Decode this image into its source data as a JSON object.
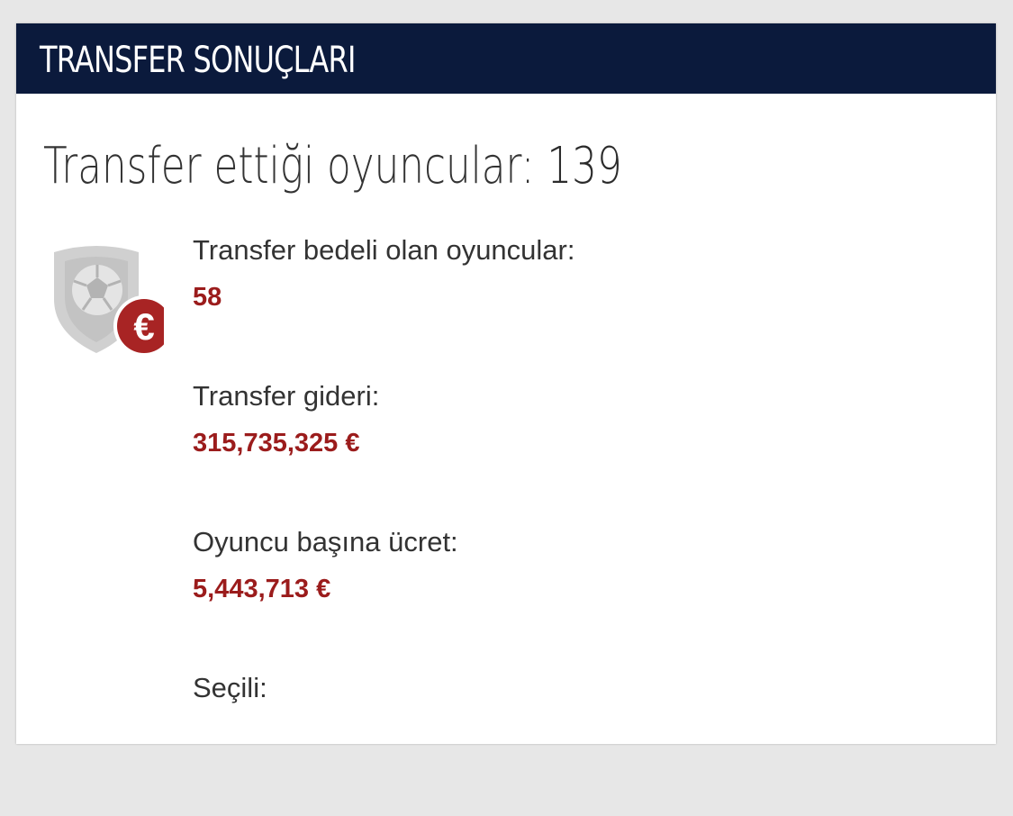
{
  "header": {
    "title": "TRANSFER SONUÇLARI"
  },
  "summary": {
    "label": "Transfer ettiği oyuncular:",
    "count": "139"
  },
  "stats": [
    {
      "label": "Transfer bedeli olan oyuncular:",
      "value": "58"
    },
    {
      "label": "Transfer gideri:",
      "value": "315,735,325 €"
    },
    {
      "label": "Oyuncu başına ücret:",
      "value": "5,443,713 €"
    },
    {
      "label": "Seçili:",
      "value": ""
    }
  ],
  "icons": {
    "badge": "shield-ball-euro-icon",
    "euro_symbol": "€"
  },
  "colors": {
    "header_bg": "#0b1a3c",
    "value_red": "#9b1c1c",
    "icon_grey": "#cccccc",
    "icon_red": "#a82424"
  }
}
